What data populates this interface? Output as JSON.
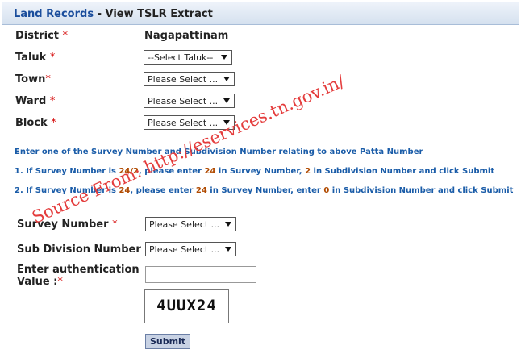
{
  "header": {
    "crumb_link": "Land Records",
    "crumb_sep": " - ",
    "title": "View TSLR Extract"
  },
  "form": {
    "district_label": "District",
    "district_value": "Nagapattinam",
    "taluk_label": "Taluk",
    "taluk_select": "--Select Taluk--",
    "town_label": "Town",
    "town_select": "Please Select ...",
    "ward_label": "Ward",
    "ward_select": "Please Select ...",
    "block_label": "Block",
    "block_select": "Please Select ...",
    "required_mark": "*"
  },
  "instructions": {
    "line1": "Enter one of the Survey Number and Subdivision Number relating to above Patta Number",
    "line2_pre": "1. If Survey Number is ",
    "line2_n1": "24/2",
    "line2_mid": ", please enter ",
    "line2_n2": "24",
    "line2_mid2": " in Survey Number, ",
    "line2_n3": "2",
    "line2_post": " in Subdivision Number and click Submit",
    "line3_pre": "2. If Survey Number is ",
    "line3_n1": "24",
    "line3_mid": ", please enter ",
    "line3_n2": "24",
    "line3_mid2": " in Survey Number, enter ",
    "line3_n3": "0",
    "line3_post": " in Subdivision Number and click Submit"
  },
  "survey": {
    "survey_label": "Survey Number",
    "survey_select": "Please Select ...",
    "subdiv_label": "Sub Division Number",
    "subdiv_select": "Please Select ...",
    "auth_label_1": "Enter authentication",
    "auth_label_2": "Value :",
    "auth_value": "",
    "captcha_text": "4UUX24",
    "submit_label": "Submit"
  },
  "watermark": "Source From: http://eservices.tn.gov.in/"
}
